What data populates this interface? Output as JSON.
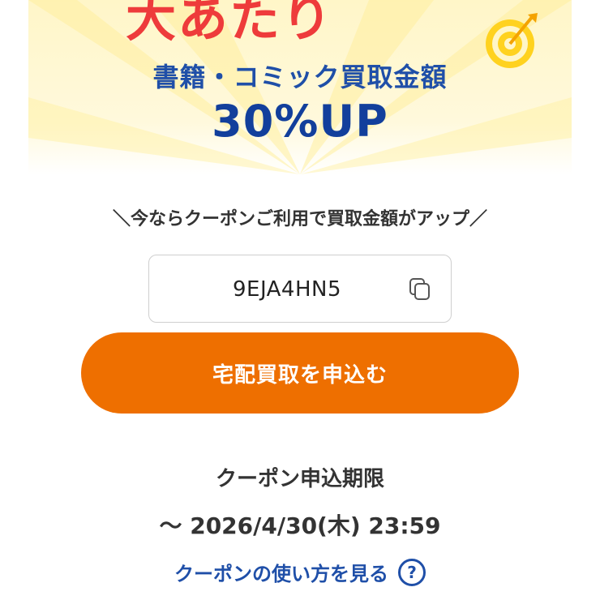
{
  "banner": {
    "headline": "大あたり",
    "subtitle": "書籍・コミック買取金額",
    "big_text": "30%UP"
  },
  "tagline": "＼今ならクーポンご利用で買取金額がアップ／",
  "coupon": {
    "code": "9EJA4HN5",
    "copy_icon": "copy-icon"
  },
  "cta": {
    "label": "宅配買取を申込む"
  },
  "deadline": {
    "label": "クーポン申込期限",
    "value": "～ 2026/4/30(木) 23:59"
  },
  "help": {
    "label": "クーポンの使い方を見る",
    "icon": "question-circle-icon",
    "icon_glyph": "?"
  },
  "colors": {
    "accent": "#ee6f00",
    "link": "#1f4fa8",
    "headline_red": "#ee3b3b",
    "banner_bg": "#fff6c8"
  }
}
